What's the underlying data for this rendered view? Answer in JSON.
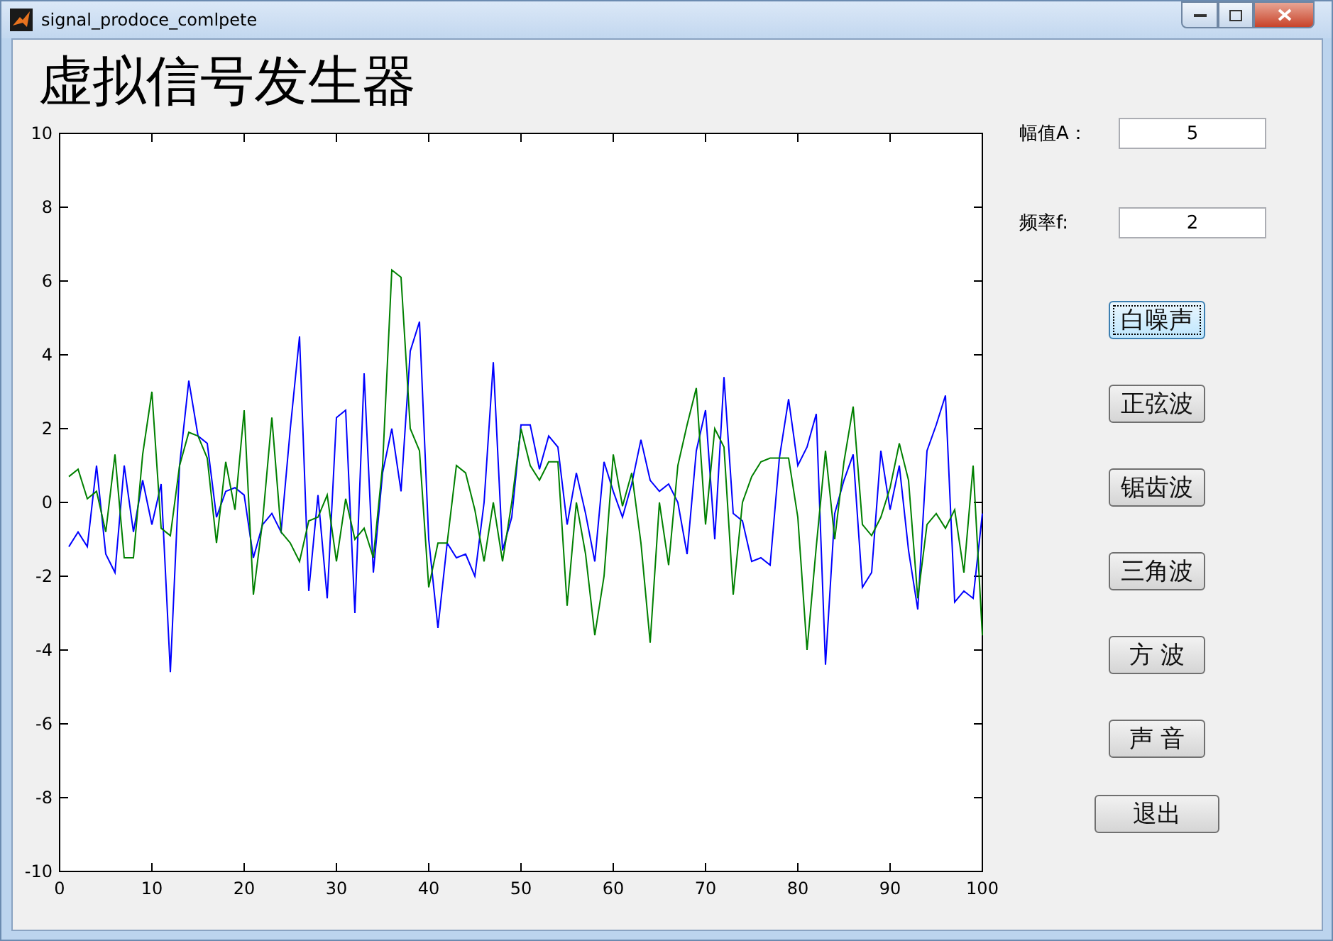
{
  "window": {
    "title": "signal_prodoce_comlpete"
  },
  "heading": "虚拟信号发生器",
  "chart": {
    "chart_data": {
      "type": "line",
      "xlim": [
        0,
        100
      ],
      "ylim": [
        -10,
        10
      ],
      "xticks": [
        0,
        10,
        20,
        30,
        40,
        50,
        60,
        70,
        80,
        90,
        100
      ],
      "yticks": [
        -10,
        -8,
        -6,
        -4,
        -2,
        0,
        2,
        4,
        6,
        8,
        10
      ],
      "x": [
        1,
        2,
        3,
        4,
        5,
        6,
        7,
        8,
        9,
        10,
        11,
        12,
        13,
        14,
        15,
        16,
        17,
        18,
        19,
        20,
        21,
        22,
        23,
        24,
        25,
        26,
        27,
        28,
        29,
        30,
        31,
        32,
        33,
        34,
        35,
        36,
        37,
        38,
        39,
        40,
        41,
        42,
        43,
        44,
        45,
        46,
        47,
        48,
        49,
        50,
        51,
        52,
        53,
        54,
        55,
        56,
        57,
        58,
        59,
        60,
        61,
        62,
        63,
        64,
        65,
        66,
        67,
        68,
        69,
        70,
        71,
        72,
        73,
        74,
        75,
        76,
        77,
        78,
        79,
        80,
        81,
        82,
        83,
        84,
        85,
        86,
        87,
        88,
        89,
        90,
        91,
        92,
        93,
        94,
        95,
        96,
        97,
        98,
        99,
        100
      ],
      "series": [
        {
          "color": "#0000ff",
          "values": [
            -1.2,
            -0.8,
            -1.2,
            1.0,
            -1.4,
            -1.9,
            1.0,
            -0.8,
            0.6,
            -0.6,
            0.5,
            -4.6,
            1.0,
            3.3,
            1.8,
            1.6,
            -0.4,
            0.3,
            0.4,
            0.2,
            -1.5,
            -0.6,
            -0.3,
            -0.8,
            2.0,
            4.5,
            -2.4,
            0.2,
            -2.6,
            2.3,
            2.5,
            -3.0,
            3.5,
            -1.9,
            0.8,
            2.0,
            0.3,
            4.1,
            4.9,
            -1.0,
            -3.4,
            -1.1,
            -1.5,
            -1.4,
            -2.0,
            0.0,
            3.8,
            -1.3,
            -0.4,
            2.1,
            2.1,
            0.9,
            1.8,
            1.5,
            -0.6,
            0.8,
            -0.3,
            -1.6,
            1.1,
            0.3,
            -0.4,
            0.5,
            1.7,
            0.6,
            0.3,
            0.5,
            0.0,
            -1.4,
            1.4,
            2.5,
            -1.0,
            3.4,
            -0.3,
            -0.5,
            -1.6,
            -1.5,
            -1.7,
            1.2,
            2.8,
            1.0,
            1.5,
            2.4,
            -4.4,
            -0.3,
            0.6,
            1.3,
            -2.3,
            -1.9,
            1.4,
            -0.2,
            1.0,
            -1.3,
            -2.9,
            1.4,
            2.1,
            2.9,
            -2.7,
            -2.4,
            -2.6,
            -0.3
          ]
        },
        {
          "color": "#008000",
          "values": [
            0.7,
            0.9,
            0.1,
            0.3,
            -0.8,
            1.3,
            -1.5,
            -1.5,
            1.3,
            3.0,
            -0.7,
            -0.9,
            1.0,
            1.9,
            1.8,
            1.2,
            -1.1,
            1.1,
            -0.2,
            2.5,
            -2.5,
            -0.5,
            2.3,
            -0.8,
            -1.1,
            -1.6,
            -0.5,
            -0.4,
            0.2,
            -1.6,
            0.1,
            -1.0,
            -0.7,
            -1.5,
            1.0,
            6.3,
            6.1,
            2.0,
            1.4,
            -2.3,
            -1.1,
            -1.1,
            1.0,
            0.8,
            -0.2,
            -1.6,
            0.0,
            -1.6,
            0.0,
            2.0,
            1.0,
            0.6,
            1.1,
            1.1,
            -2.8,
            0.0,
            -1.4,
            -3.6,
            -2.0,
            1.3,
            -0.1,
            0.8,
            -1.1,
            -3.8,
            0.0,
            -1.7,
            1.0,
            2.1,
            3.1,
            -0.6,
            2.0,
            1.5,
            -2.5,
            0.0,
            0.7,
            1.1,
            1.2,
            1.2,
            1.2,
            -0.4,
            -4.0,
            -1.2,
            1.4,
            -1.0,
            1.1,
            2.6,
            -0.6,
            -0.9,
            -0.4,
            0.4,
            1.6,
            0.6,
            -2.6,
            -0.6,
            -0.3,
            -0.7,
            -0.2,
            -1.9,
            1.0,
            -3.6
          ]
        }
      ]
    }
  },
  "fields": [
    {
      "label": "幅值A：",
      "value": "5"
    },
    {
      "label": "频率f:",
      "value": "2"
    }
  ],
  "buttons": [
    {
      "label": "白噪声",
      "focused": true
    },
    {
      "label": "正弦波",
      "focused": false
    },
    {
      "label": "锯齿波",
      "focused": false
    },
    {
      "label": "三角波",
      "focused": false
    },
    {
      "label": "方 波",
      "focused": false
    },
    {
      "label": "声 音",
      "focused": false
    }
  ],
  "exit_button": {
    "label": "退出"
  }
}
